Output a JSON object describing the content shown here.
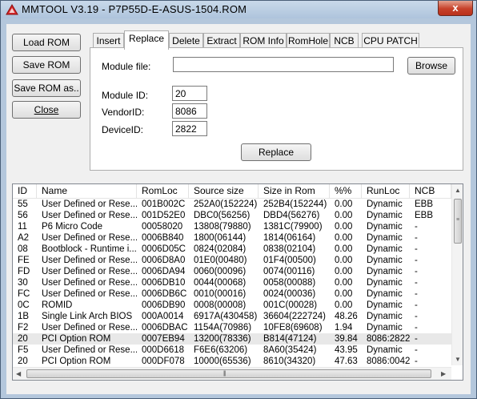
{
  "window": {
    "title": "MMTOOL V3.19 - P7P55D-E-ASUS-1504.ROM",
    "close_label": "x",
    "icon": "app-triangle-icon"
  },
  "side_buttons": {
    "load": "Load ROM",
    "save": "Save ROM",
    "save_as": "Save ROM as..",
    "close": "Close"
  },
  "tabs": [
    "Insert",
    "Replace",
    "Delete",
    "Extract",
    "ROM Info",
    "RomHole",
    "NCB",
    "CPU PATCH"
  ],
  "active_tab": "Replace",
  "replace_panel": {
    "module_file_label": "Module file:",
    "module_file_value": "",
    "browse_label": "Browse",
    "module_id_label": "Module ID:",
    "module_id_value": "20",
    "vendor_id_label": "VendorID:",
    "vendor_id_value": "8086",
    "device_id_label": "DeviceID:",
    "device_id_value": "2822",
    "replace_label": "Replace"
  },
  "module_table": {
    "columns": [
      "ID",
      "Name",
      "RomLoc",
      "Source size",
      "Size in Rom",
      "%%",
      "RunLoc",
      "NCB"
    ],
    "rows": [
      [
        "55",
        "User Defined or Rese...",
        "001B002C",
        "252A0(152224)",
        "252B4(152244)",
        "0.00",
        "Dynamic",
        "EBB"
      ],
      [
        "56",
        "User Defined or Rese...",
        "001D52E0",
        "DBC0(56256)",
        "DBD4(56276)",
        "0.00",
        "Dynamic",
        "EBB"
      ],
      [
        "11",
        "P6 Micro Code",
        "00058020",
        "13808(79880)",
        "1381C(79900)",
        "0.00",
        "Dynamic",
        "-"
      ],
      [
        "A2",
        "User Defined or Rese...",
        "0006B840",
        "1800(06144)",
        "1814(06164)",
        "0.00",
        "Dynamic",
        "-"
      ],
      [
        "08",
        "Bootblock - Runtime i...",
        "0006D05C",
        "0824(02084)",
        "0838(02104)",
        "0.00",
        "Dynamic",
        "-"
      ],
      [
        "FE",
        "User Defined or Rese...",
        "0006D8A0",
        "01E0(00480)",
        "01F4(00500)",
        "0.00",
        "Dynamic",
        "-"
      ],
      [
        "FD",
        "User Defined or Rese...",
        "0006DA94",
        "0060(00096)",
        "0074(00116)",
        "0.00",
        "Dynamic",
        "-"
      ],
      [
        "30",
        "User Defined or Rese...",
        "0006DB10",
        "0044(00068)",
        "0058(00088)",
        "0.00",
        "Dynamic",
        "-"
      ],
      [
        "FC",
        "User Defined or Rese...",
        "0006DB6C",
        "0010(00016)",
        "0024(00036)",
        "0.00",
        "Dynamic",
        "-"
      ],
      [
        "0C",
        "ROMID",
        "0006DB90",
        "0008(00008)",
        "001C(00028)",
        "0.00",
        "Dynamic",
        "-"
      ],
      [
        "1B",
        "Single Link Arch BIOS",
        "000A0014",
        "6917A(430458)",
        "36604(222724)",
        "48.26",
        "Dynamic",
        "-"
      ],
      [
        "F2",
        "User Defined or Rese...",
        "0006DBAC",
        "1154A(70986)",
        "10FE8(69608)",
        "1.94",
        "Dynamic",
        "-"
      ],
      [
        "20",
        "PCI Option ROM",
        "0007EB94",
        "13200(78336)",
        "B814(47124)",
        "39.84",
        "8086:2822",
        "-"
      ],
      [
        "F5",
        "User Defined or Rese...",
        "000D6618",
        "F6E6(63206)",
        "8A60(35424)",
        "43.95",
        "Dynamic",
        "-"
      ],
      [
        "20",
        "PCI Option ROM",
        "000DF078",
        "10000(65536)",
        "8610(34320)",
        "47.63",
        "8086:0042",
        "-"
      ]
    ],
    "selected_row": 12
  }
}
